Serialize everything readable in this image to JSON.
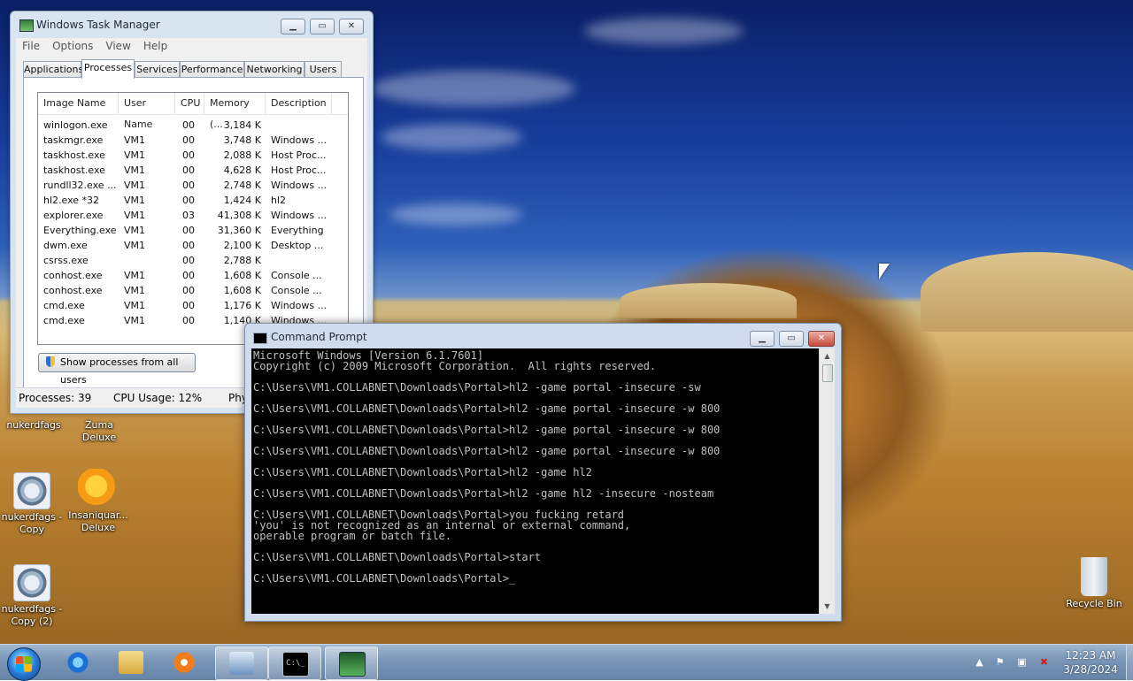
{
  "task_manager": {
    "title": "Windows Task Manager",
    "menu": [
      "File",
      "Options",
      "View",
      "Help"
    ],
    "tabs": [
      "Applications",
      "Processes",
      "Services",
      "Performance",
      "Networking",
      "Users"
    ],
    "active_tab": "Processes",
    "columns": [
      "Image Name",
      "User Name",
      "CPU",
      "Memory (...",
      "Description"
    ],
    "rows": [
      {
        "image": "winlogon.exe",
        "user": "",
        "cpu": "00",
        "memory": "3,184 K",
        "desc": ""
      },
      {
        "image": "taskmgr.exe",
        "user": "VM1",
        "cpu": "00",
        "memory": "3,748 K",
        "desc": "Windows ..."
      },
      {
        "image": "taskhost.exe",
        "user": "VM1",
        "cpu": "00",
        "memory": "2,088 K",
        "desc": "Host Proc..."
      },
      {
        "image": "taskhost.exe",
        "user": "VM1",
        "cpu": "00",
        "memory": "4,628 K",
        "desc": "Host Proc..."
      },
      {
        "image": "rundll32.exe ...",
        "user": "VM1",
        "cpu": "00",
        "memory": "2,748 K",
        "desc": "Windows ..."
      },
      {
        "image": "hl2.exe *32",
        "user": "VM1",
        "cpu": "00",
        "memory": "1,424 K",
        "desc": "hl2"
      },
      {
        "image": "explorer.exe",
        "user": "VM1",
        "cpu": "03",
        "memory": "41,308 K",
        "desc": "Windows ..."
      },
      {
        "image": "Everything.exe",
        "user": "VM1",
        "cpu": "00",
        "memory": "31,360 K",
        "desc": "Everything"
      },
      {
        "image": "dwm.exe",
        "user": "VM1",
        "cpu": "00",
        "memory": "2,100 K",
        "desc": "Desktop ..."
      },
      {
        "image": "csrss.exe",
        "user": "",
        "cpu": "00",
        "memory": "2,788 K",
        "desc": ""
      },
      {
        "image": "conhost.exe",
        "user": "VM1",
        "cpu": "00",
        "memory": "1,608 K",
        "desc": "Console ..."
      },
      {
        "image": "conhost.exe",
        "user": "VM1",
        "cpu": "00",
        "memory": "1,608 K",
        "desc": "Console ..."
      },
      {
        "image": "cmd.exe",
        "user": "VM1",
        "cpu": "00",
        "memory": "1,176 K",
        "desc": "Windows ..."
      },
      {
        "image": "cmd.exe",
        "user": "VM1",
        "cpu": "00",
        "memory": "1,140 K",
        "desc": "Windows ..."
      }
    ],
    "show_all_button": "Show processes from all users",
    "status": {
      "processes": "Processes: 39",
      "cpu": "CPU Usage: 12%",
      "physical": "Phy"
    }
  },
  "cmd": {
    "title": "Command Prompt",
    "lines": [
      "Microsoft Windows [Version 6.1.7601]",
      "Copyright (c) 2009 Microsoft Corporation.  All rights reserved.",
      "",
      "C:\\Users\\VM1.COLLABNET\\Downloads\\Portal>hl2 -game portal -insecure -sw",
      "",
      "C:\\Users\\VM1.COLLABNET\\Downloads\\Portal>hl2 -game portal -insecure -w 800",
      "",
      "C:\\Users\\VM1.COLLABNET\\Downloads\\Portal>hl2 -game portal -insecure -w 800",
      "",
      "C:\\Users\\VM1.COLLABNET\\Downloads\\Portal>hl2 -game portal -insecure -w 800",
      "",
      "C:\\Users\\VM1.COLLABNET\\Downloads\\Portal>hl2 -game hl2",
      "",
      "C:\\Users\\VM1.COLLABNET\\Downloads\\Portal>hl2 -game hl2 -insecure -nosteam",
      "",
      "C:\\Users\\VM1.COLLABNET\\Downloads\\Portal>you fucking retard",
      "'you' is not recognized as an internal or external command,",
      "operable program or batch file.",
      "",
      "C:\\Users\\VM1.COLLABNET\\Downloads\\Portal>start",
      "",
      "C:\\Users\\VM1.COLLABNET\\Downloads\\Portal>_"
    ]
  },
  "desktop_icons": [
    {
      "label": "nukerdfags",
      "icon": "gear-icon"
    },
    {
      "label": "Zuma Deluxe",
      "icon": "zuma-icon"
    },
    {
      "label": "nukerdfags - Copy",
      "icon": "gear-icon"
    },
    {
      "label": "Insaniquar... Deluxe",
      "icon": "fish-icon"
    },
    {
      "label": "nukerdfags - Copy (2)",
      "icon": "gear-icon"
    },
    {
      "label": "Recycle Bin",
      "icon": "recycle-bin-icon"
    }
  ],
  "taskbar": {
    "clock_time": "12:23 AM",
    "clock_date": "3/28/2024",
    "pinned": [
      "ie-icon",
      "folder-icon",
      "media-player-icon",
      "control-panel-icon",
      "cmd-icon",
      "task-manager-icon"
    ]
  }
}
